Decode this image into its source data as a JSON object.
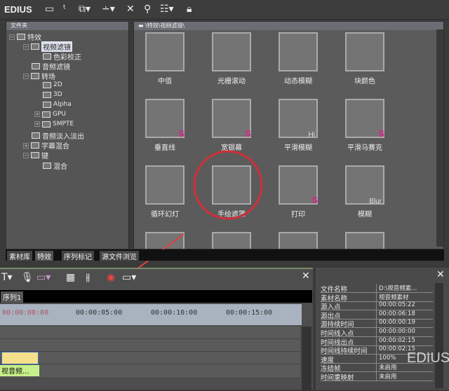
{
  "app": {
    "title": "EDIUS"
  },
  "toolbar": {
    "icons": [
      "folder-icon",
      "up-icon",
      "folder-view-icon",
      "line-icon",
      "delete-icon",
      "search-icon",
      "view-icon",
      "lock-icon"
    ]
  },
  "tree": {
    "header": "文件夹",
    "items": [
      {
        "label": "特效"
      },
      {
        "label": "视频滤镜"
      },
      {
        "label": "色彩校正"
      },
      {
        "label": "音频滤镜"
      },
      {
        "label": "转场"
      },
      {
        "label": "2D"
      },
      {
        "label": "3D"
      },
      {
        "label": "Alpha"
      },
      {
        "label": "GPU"
      },
      {
        "label": "SMPTE"
      },
      {
        "label": "音频淡入淡出"
      },
      {
        "label": "字幕混合"
      },
      {
        "label": "键"
      },
      {
        "label": "混合"
      }
    ]
  },
  "grid": {
    "path": "\\特效\\视频滤镜\\",
    "tiles": [
      {
        "label": "中值"
      },
      {
        "label": "光栅滚动"
      },
      {
        "label": "动态模糊"
      },
      {
        "label": "块颜色"
      },
      {
        "label": "垂直线",
        "badge": "S"
      },
      {
        "label": "宽银幕",
        "badge": "S"
      },
      {
        "label": "平滑模糊",
        "badge": "Hi"
      },
      {
        "label": "平滑马赛克",
        "badge": "S"
      },
      {
        "label": "循环幻灯"
      },
      {
        "label": "手绘遮罩"
      },
      {
        "label": "打印",
        "badge": "S"
      },
      {
        "label": "模糊",
        "badge": "Blur"
      }
    ]
  },
  "bottom_tabs": [
    "素材库",
    "特效",
    "序列标记",
    "源文件浏览"
  ],
  "timeline": {
    "sequence_tab": "序列1",
    "timecodes": [
      "00:00:00:00",
      "00:00:05:00",
      "00:00:10:00",
      "00:00:15:00"
    ],
    "clip_label": "视音频..."
  },
  "info": {
    "rows": [
      {
        "k": "文件名称",
        "v": "D:\\视音频素..."
      },
      {
        "k": "素材名称",
        "v": "视音频素材"
      },
      {
        "k": "源入点",
        "v": "00:00:05:22"
      },
      {
        "k": "源出点",
        "v": "00:00:06:18"
      },
      {
        "k": "源持续时间",
        "v": "00:00:00:19"
      },
      {
        "k": "时间线入点",
        "v": "00:00:00:00"
      },
      {
        "k": "时间线出点",
        "v": "00:00:02:15"
      },
      {
        "k": "时间线持续时间",
        "v": "00:00:02:15"
      },
      {
        "k": "速度",
        "v": "100%"
      },
      {
        "k": "冻结帧",
        "v": "未启用"
      },
      {
        "k": "时间重映射",
        "v": "未启用"
      }
    ]
  },
  "watermark": "EDIUS",
  "colors": {
    "highlight": "#d0303a",
    "badge": "#e0208a"
  }
}
